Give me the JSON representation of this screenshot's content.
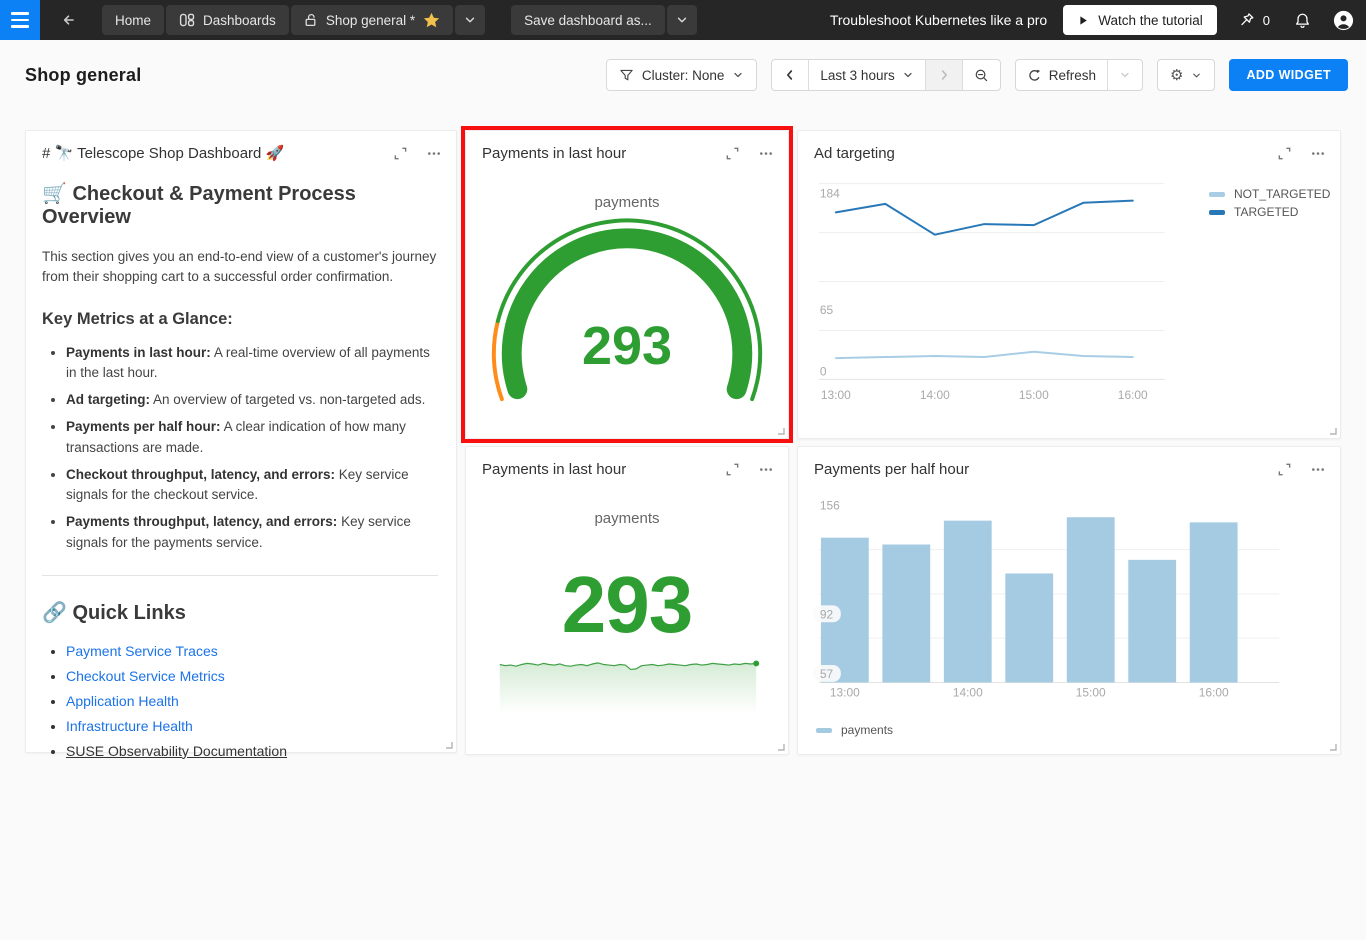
{
  "topbar": {
    "home_label": "Home",
    "dashboards_label": "Dashboards",
    "current_tab_label": "Shop general *",
    "save_label": "Save dashboard as...",
    "promo_text": "Troubleshoot Kubernetes like a pro",
    "watch_button_label": "Watch the tutorial",
    "pin_count": "0"
  },
  "header": {
    "title": "Shop general",
    "cluster_label": "Cluster: None",
    "time_range": "Last 3 hours",
    "refresh_label": "Refresh",
    "add_widget_label": "ADD WIDGET"
  },
  "markdown": {
    "title": "# 🔭 Telescope Shop Dashboard 🚀",
    "heading": "🛒 Checkout & Payment Process Overview",
    "intro": "This section gives you an end-to-end view of a customer's journey from their shopping cart to a successful order confirmation.",
    "metrics_heading": "Key Metrics at a Glance:",
    "metrics": [
      {
        "term": "Payments in last hour:",
        "desc": "A real-time overview of all payments in the last hour."
      },
      {
        "term": "Ad targeting:",
        "desc": "An overview of targeted vs. non-targeted ads."
      },
      {
        "term": "Payments per half hour:",
        "desc": "A clear indication of how many transactions are made."
      },
      {
        "term": "Checkout throughput, latency, and errors:",
        "desc": "Key service signals for the checkout service."
      },
      {
        "term": "Payments throughput, latency, and errors:",
        "desc": "Key service signals for the payments service."
      }
    ],
    "quick_links_heading": "🔗 Quick Links",
    "links": [
      "Payment Service Traces",
      "Checkout Service Metrics",
      "Application Health",
      "Infrastructure Health"
    ],
    "plain_link": "SUSE Observability Documentation"
  },
  "colors": {
    "accent_blue": "#0b81f5",
    "highlight_red": "#f80f0f",
    "gauge_green": "#2f9e32",
    "gauge_orange": "#ff8c1a",
    "bar_blue": "#a5cbe2",
    "line_dark_blue": "#2878b8",
    "line_light_blue": "#a8cde4",
    "link_blue": "#1a73e8",
    "star_yellow": "#f2c14b",
    "topbar_bg": "#262626"
  },
  "chart_data": [
    {
      "id": "payments-gauge",
      "type": "gauge",
      "title": "Payments in last hour",
      "series_label": "payments",
      "value": 293,
      "value_color": "#2f9e32",
      "track_low_color": "#ff8c1a",
      "track_high_color": "#2f9e32",
      "track_low_fraction": 0.155
    },
    {
      "id": "ad-targeting",
      "type": "line",
      "title": "Ad targeting",
      "x": [
        "13:00",
        "13:30",
        "14:00",
        "14:30",
        "15:00",
        "15:30",
        "16:00"
      ],
      "x_ticks": [
        "13:00",
        "14:00",
        "15:00",
        "16:00"
      ],
      "series": [
        {
          "name": "NOT_TARGETED",
          "color": "#a8cde4",
          "values": [
            20,
            21,
            22,
            21,
            26,
            22,
            21
          ]
        },
        {
          "name": "TARGETED",
          "color": "#2878b8",
          "values": [
            157,
            165,
            136,
            146,
            145,
            166,
            168
          ]
        }
      ],
      "ylim": [
        0,
        184
      ],
      "y_ticks": [
        184,
        65,
        0
      ],
      "grid": true,
      "legend_position": "right"
    },
    {
      "id": "payments-number",
      "type": "area-sparkline",
      "title": "Payments in last hour",
      "series_label": "payments",
      "value": 293,
      "color": "#2f9e32",
      "values": [
        291,
        289,
        290,
        288,
        291,
        293,
        292,
        290,
        293,
        291,
        290,
        292,
        289,
        288,
        290,
        291,
        289,
        292,
        294,
        291,
        290,
        289,
        291,
        290,
        282,
        283,
        289,
        290,
        291,
        289,
        290,
        292,
        291,
        290,
        289,
        291,
        292,
        290,
        291,
        293,
        292,
        291,
        290,
        292,
        291,
        293,
        292,
        293
      ]
    },
    {
      "id": "payments-per-half-hour",
      "type": "bar",
      "title": "Payments per half hour",
      "categories": [
        "13:00",
        "13:30",
        "14:00",
        "14:30",
        "15:00",
        "15:30",
        "16:00"
      ],
      "x_ticks": [
        "13:00",
        "14:00",
        "15:00",
        "16:00"
      ],
      "series": [
        {
          "name": "payments",
          "color": "#a5cbe2",
          "values": [
            137,
            133,
            147,
            116,
            149,
            124,
            146
          ]
        }
      ],
      "ylim": [
        52,
        156
      ],
      "y_ticks": [
        156,
        92,
        57
      ],
      "grid": true,
      "legend_position": "bottom"
    }
  ]
}
